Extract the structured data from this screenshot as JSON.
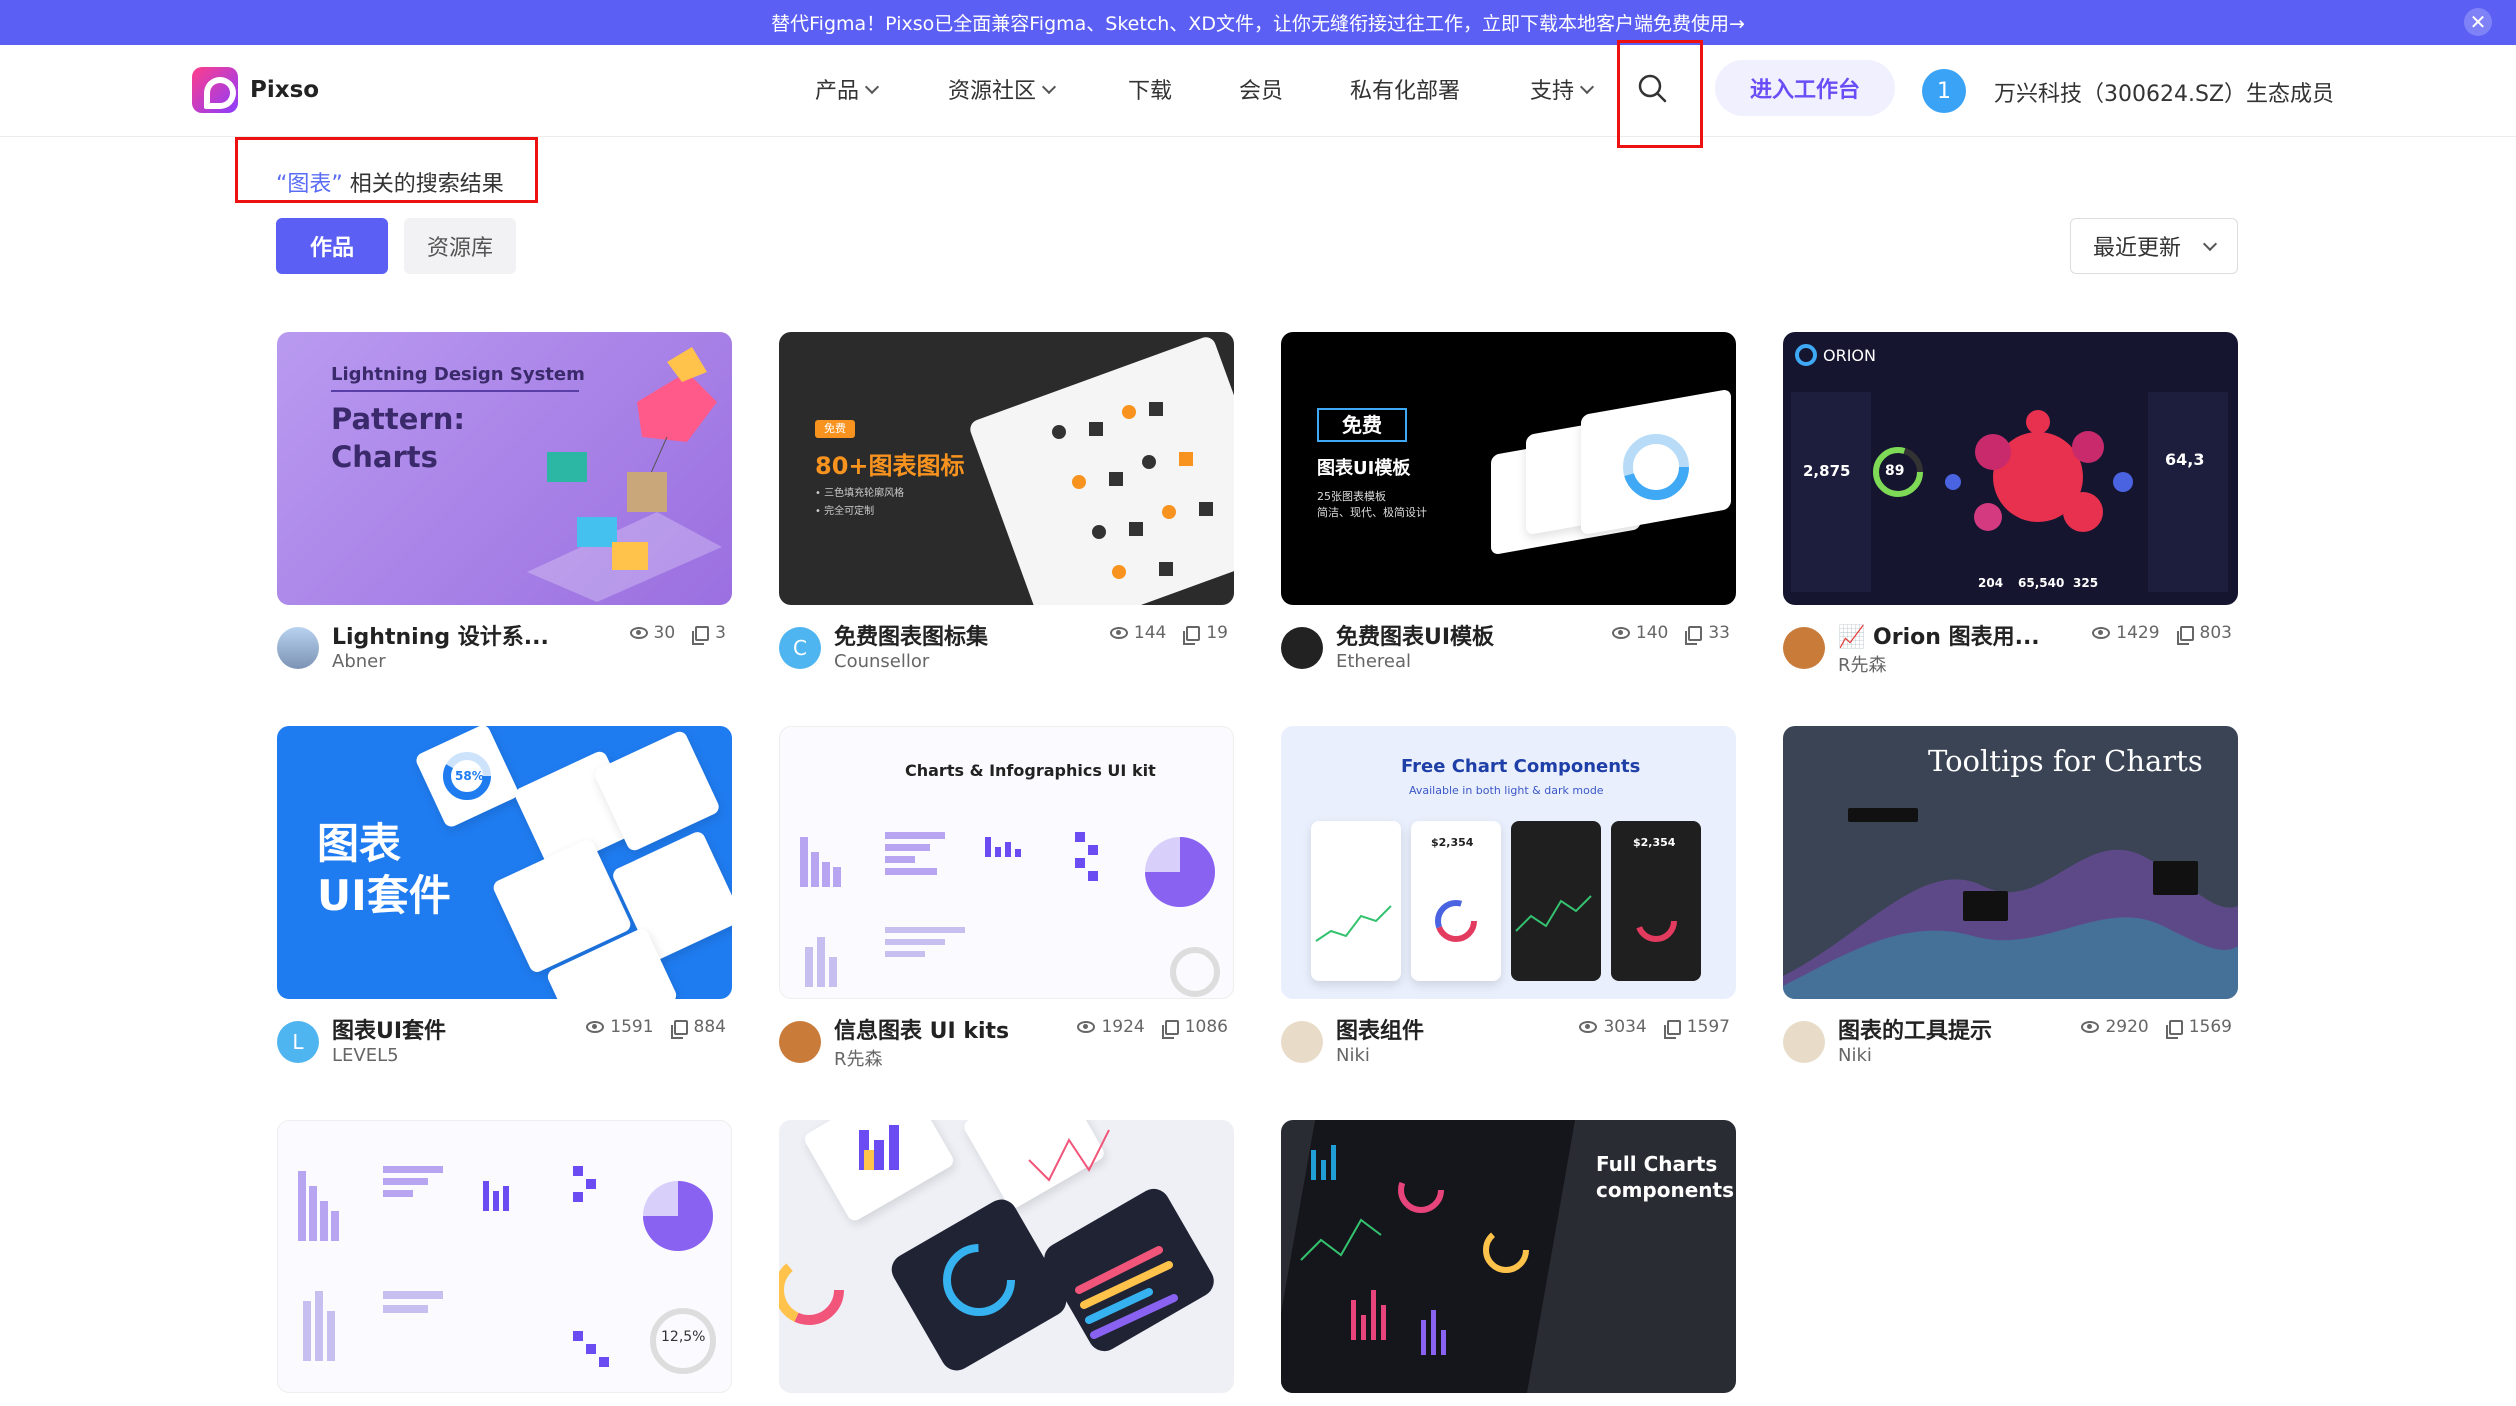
{
  "banner": {
    "text": "替代Figma！Pixso已全面兼容Figma、Sketch、XD文件，让你无缝衔接过往工作，立即下载本地客户端免费使用→",
    "close": "✕"
  },
  "nav": {
    "logo": "Pixso",
    "items": [
      {
        "label": "产品",
        "dropdown": true
      },
      {
        "label": "资源社区",
        "dropdown": true
      },
      {
        "label": "下载",
        "dropdown": false
      },
      {
        "label": "会员",
        "dropdown": false
      },
      {
        "label": "私有化部署",
        "dropdown": false
      },
      {
        "label": "支持",
        "dropdown": true
      }
    ],
    "workspace_button": "进入工作台",
    "avatar": "1",
    "member_text": "万兴科技（300624.SZ）生态成员"
  },
  "search": {
    "keyword": "“图表”",
    "suffix": " 相关的搜索结果",
    "tabs": [
      "作品",
      "资源库"
    ],
    "sort": "最近更新"
  },
  "thumb_text": {
    "lightning": {
      "l1": "Lightning Design System",
      "l2": "Pattern:",
      "l3": "Charts"
    },
    "icons": {
      "badge": "免费",
      "title": "80+图表图标",
      "b1": "• 三色填充轮廓风格",
      "b2": "• 完全可定制"
    },
    "uitpl": {
      "badge": "免费",
      "title": "图表UI模板",
      "sub1": "25张图表模板",
      "sub2": "简洁、现代、极简设计"
    },
    "orion": {
      "brand": "ORION",
      "gauge": "89",
      "big": "2,875",
      "right": "64,3",
      "n1": "204",
      "n2": "65,540",
      "n3": "325"
    },
    "kit": {
      "l1": "图表",
      "l2": "UI套件",
      "pct": "58%"
    },
    "infographics": {
      "title": "Charts & Infographics UI kit"
    },
    "components": {
      "title": "Free Chart Components",
      "sub": "Available in both light & dark mode",
      "v1": "$2,354",
      "v2": "$2,354"
    },
    "tooltips": {
      "title": "Tooltips for Charts"
    },
    "purple": {
      "value": "12,5%"
    },
    "full": {
      "l1": "Full Charts",
      "l2": "components"
    }
  },
  "cards": [
    {
      "title": "Lightning 设计系...",
      "author": "Abner",
      "views": "30",
      "dups": "3",
      "avatar": ""
    },
    {
      "title": "免费图表图标集",
      "author": "Counsellor",
      "views": "144",
      "dups": "19",
      "avatar": "C"
    },
    {
      "title": "免费图表UI模板",
      "author": "Ethereal",
      "views": "140",
      "dups": "33",
      "avatar": ""
    },
    {
      "title": "📈 Orion 图表用...",
      "author": "R先森",
      "views": "1429",
      "dups": "803",
      "avatar": ""
    },
    {
      "title": "图表UI套件",
      "author": "LEVEL5",
      "views": "1591",
      "dups": "884",
      "avatar": "L"
    },
    {
      "title": "信息图表 UI kits",
      "author": "R先森",
      "views": "1924",
      "dups": "1086",
      "avatar": ""
    },
    {
      "title": "图表组件",
      "author": "Niki",
      "views": "3034",
      "dups": "1597",
      "avatar": ""
    },
    {
      "title": "图表的工具提示",
      "author": "Niki",
      "views": "2920",
      "dups": "1569",
      "avatar": ""
    }
  ]
}
